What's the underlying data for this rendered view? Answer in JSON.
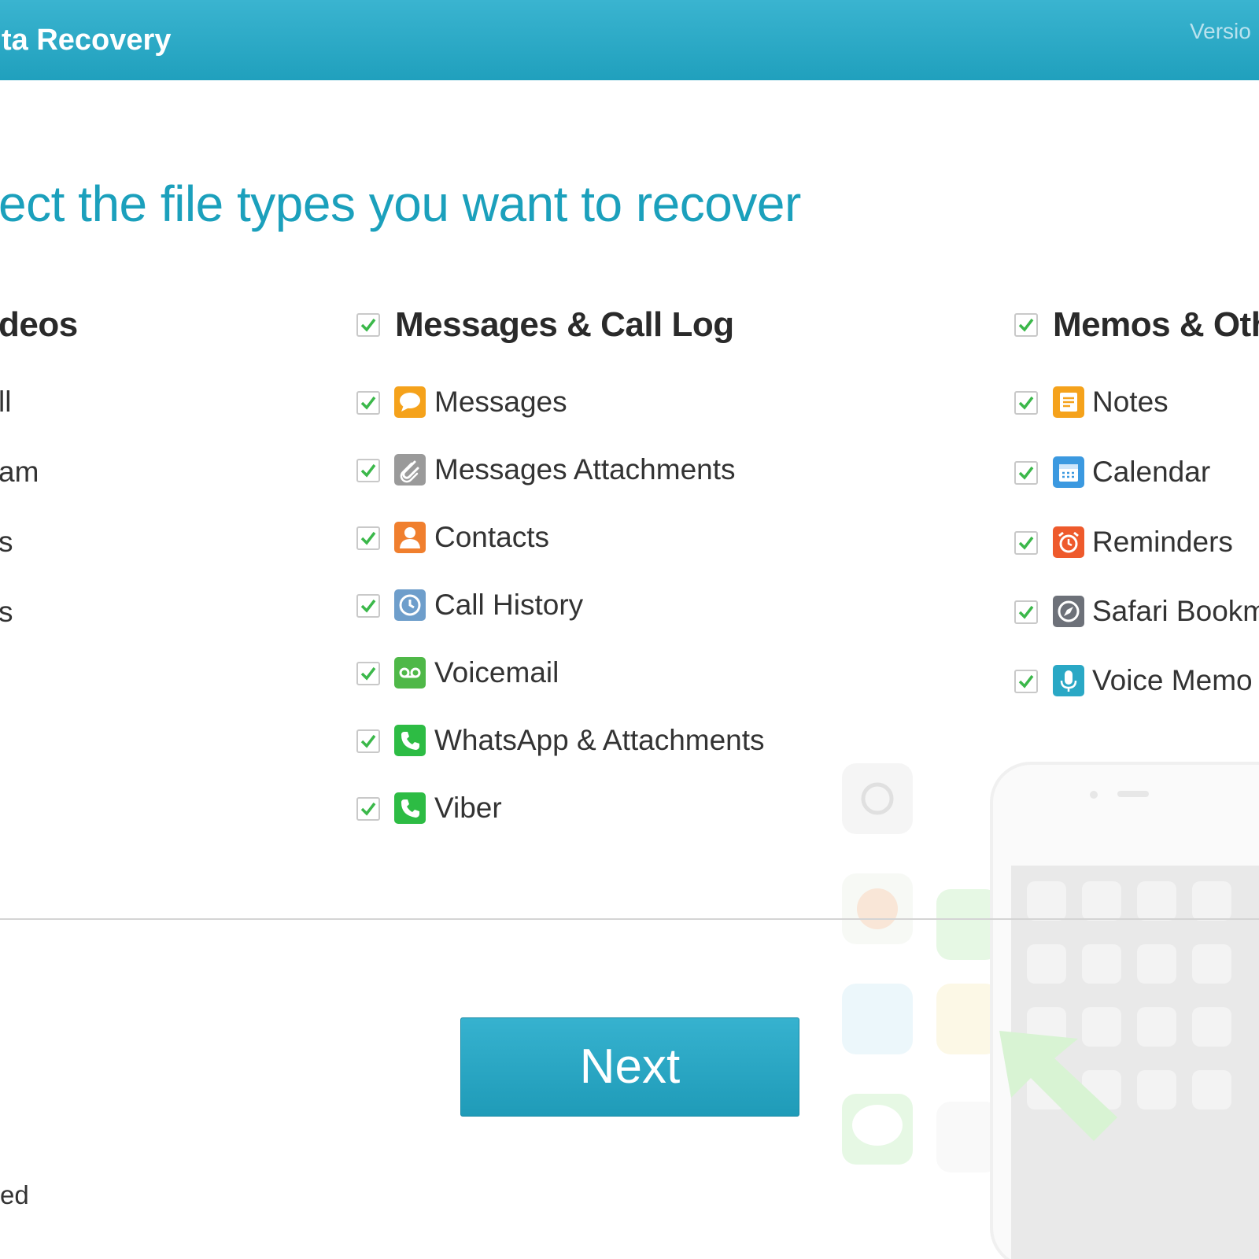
{
  "window": {
    "title": "ta Recovery",
    "version": "Versio"
  },
  "heading": "ect the file types you want to recover",
  "left_column": {
    "header": "deos",
    "items": [
      "ll",
      "am",
      "s",
      "s"
    ],
    "footer": "ed"
  },
  "messages_column": {
    "header": "Messages & Call Log",
    "items": [
      {
        "label": "Messages",
        "icon": "message-bubble-icon",
        "checked": true
      },
      {
        "label": "Messages Attachments",
        "icon": "paperclip-icon",
        "checked": true
      },
      {
        "label": "Contacts",
        "icon": "contact-person-icon",
        "checked": true
      },
      {
        "label": "Call History",
        "icon": "clock-icon",
        "checked": true
      },
      {
        "label": "Voicemail",
        "icon": "voicemail-icon",
        "checked": true
      },
      {
        "label": "WhatsApp & Attachments",
        "icon": "whatsapp-phone-icon",
        "checked": true
      },
      {
        "label": "Viber",
        "icon": "viber-phone-icon",
        "checked": true
      }
    ]
  },
  "memos_column": {
    "header": "Memos & Oth",
    "items": [
      {
        "label": "Notes",
        "icon": "notes-icon",
        "checked": true
      },
      {
        "label": "Calendar",
        "icon": "calendar-icon",
        "checked": true
      },
      {
        "label": "Reminders",
        "icon": "alarm-clock-icon",
        "checked": true
      },
      {
        "label": "Safari Bookm",
        "icon": "compass-icon",
        "checked": true
      },
      {
        "label": "Voice Memo",
        "icon": "microphone-icon",
        "checked": true
      }
    ]
  },
  "next_button": {
    "label": "Next"
  },
  "colors": {
    "accent": "#1ba0bc",
    "titlebar": "#2aa8c5",
    "check": "#3bb84a"
  }
}
